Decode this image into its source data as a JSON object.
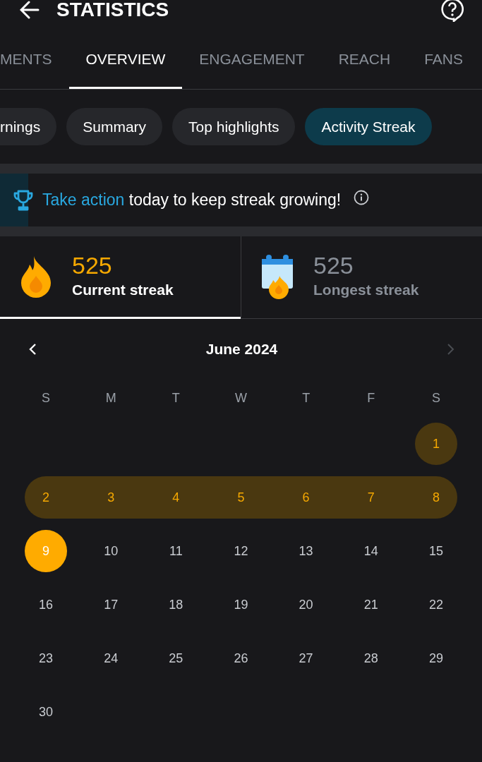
{
  "header": {
    "title": "STATISTICS"
  },
  "tabs": [
    {
      "label": "MENTS",
      "selected": false
    },
    {
      "label": "OVERVIEW",
      "selected": true
    },
    {
      "label": "ENGAGEMENT",
      "selected": false
    },
    {
      "label": "REACH",
      "selected": false
    },
    {
      "label": "FANS",
      "selected": false
    }
  ],
  "chips": [
    {
      "label": "rnings",
      "selected": false
    },
    {
      "label": "Summary",
      "selected": false
    },
    {
      "label": "Top highlights",
      "selected": false
    },
    {
      "label": "Activity Streak",
      "selected": true
    }
  ],
  "banner": {
    "link": "Take action",
    "text": "today to keep streak growing!"
  },
  "streaks": [
    {
      "kind": "current",
      "value": "525",
      "label": "Current streak",
      "selected": true
    },
    {
      "kind": "longest",
      "value": "525",
      "label": "Longest streak",
      "selected": false
    }
  ],
  "calendar": {
    "month": "June 2024",
    "next_disabled": true,
    "weekdays": [
      "S",
      "M",
      "T",
      "W",
      "T",
      "F",
      "S"
    ],
    "weeks": [
      {
        "kind": "first",
        "days": [
          {
            "day": "1",
            "kind": "streak"
          }
        ]
      },
      {
        "kind": "full",
        "days": [
          {
            "day": "2",
            "kind": "streak"
          },
          {
            "day": "3",
            "kind": "streak"
          },
          {
            "day": "4",
            "kind": "streak"
          },
          {
            "day": "5",
            "kind": "streak"
          },
          {
            "day": "6",
            "kind": "streak"
          },
          {
            "day": "7",
            "kind": "streak"
          },
          {
            "day": "8",
            "kind": "streak"
          }
        ]
      },
      {
        "kind": "full",
        "days": [
          {
            "day": "9",
            "kind": "today"
          },
          {
            "day": "10",
            "kind": "plain"
          },
          {
            "day": "11",
            "kind": "plain"
          },
          {
            "day": "12",
            "kind": "plain"
          },
          {
            "day": "13",
            "kind": "plain"
          },
          {
            "day": "14",
            "kind": "plain"
          },
          {
            "day": "15",
            "kind": "plain"
          }
        ]
      },
      {
        "kind": "full",
        "days": [
          {
            "day": "16",
            "kind": "plain"
          },
          {
            "day": "17",
            "kind": "plain"
          },
          {
            "day": "18",
            "kind": "plain"
          },
          {
            "day": "19",
            "kind": "plain"
          },
          {
            "day": "20",
            "kind": "plain"
          },
          {
            "day": "21",
            "kind": "plain"
          },
          {
            "day": "22",
            "kind": "plain"
          }
        ]
      },
      {
        "kind": "full",
        "days": [
          {
            "day": "23",
            "kind": "plain"
          },
          {
            "day": "24",
            "kind": "plain"
          },
          {
            "day": "25",
            "kind": "plain"
          },
          {
            "day": "26",
            "kind": "plain"
          },
          {
            "day": "27",
            "kind": "plain"
          },
          {
            "day": "28",
            "kind": "plain"
          },
          {
            "day": "29",
            "kind": "plain"
          }
        ]
      },
      {
        "kind": "last",
        "days": [
          {
            "day": "30",
            "kind": "plain"
          }
        ]
      }
    ]
  }
}
